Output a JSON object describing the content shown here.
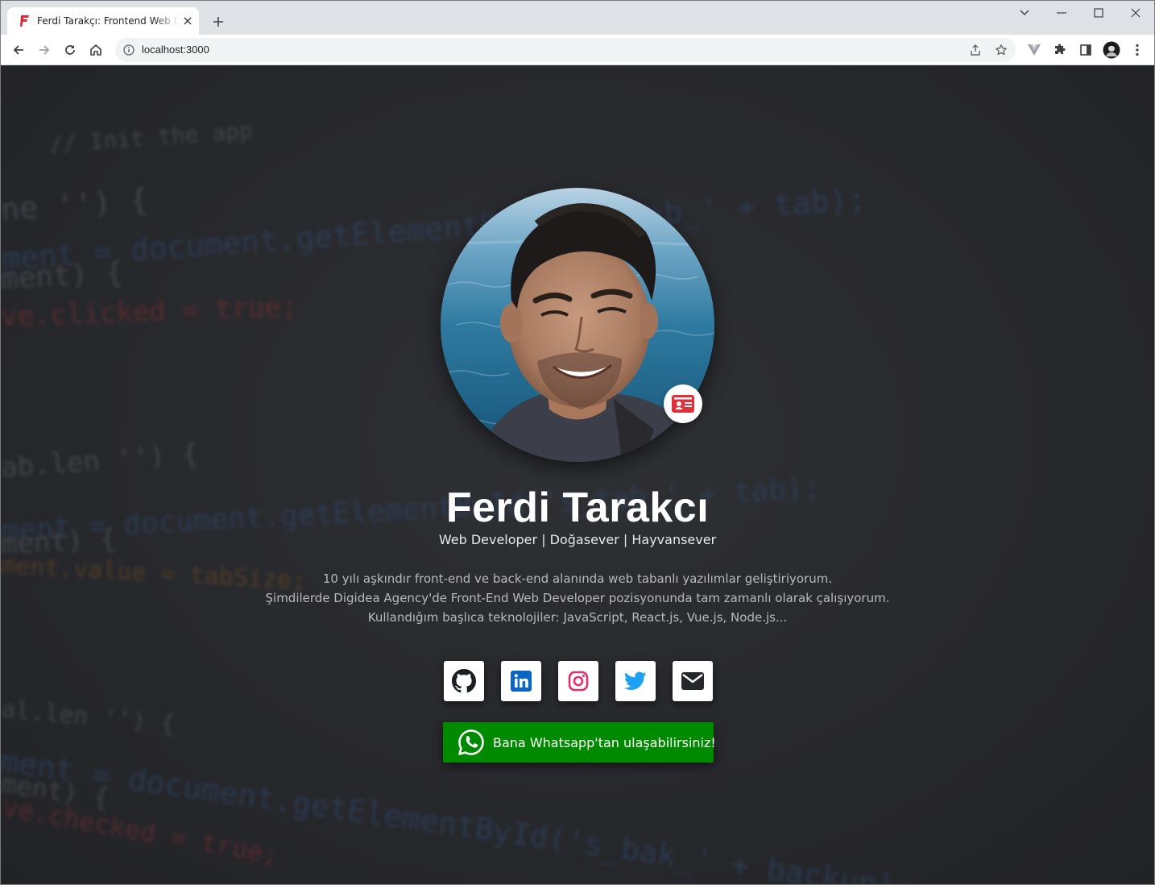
{
  "browser": {
    "tab_title": "Ferdi Tarakçı: Frontend Web Developer",
    "url": "localhost:3000",
    "colors": {
      "favicon": "#e0282f",
      "tabstrip": "#dee1e6"
    }
  },
  "background_code": {
    "lines": [
      "  // Init the app",
      "ne '') {",
      "ment = document.getElementById('s_tab_' + tab);",
      "ment) {",
      "ve.clicked = true;",
      "ab.len '') {",
      "ment = document.getElementById('s_tab_' + tab);",
      "ment) {",
      "ment.value = tabSize;",
      "al.len '') {",
      "ment = document.getElementById('s_bak_' + backup);",
      "ment) {",
      "ve.checked = true;"
    ]
  },
  "profile": {
    "name": "Ferdi Tarakcı",
    "roles": "Web Developer | Doğasever | Hayvansever",
    "bio": [
      "10 yılı aşkındır front-end ve back-end alanında web tabanlı yazılımlar geliştiriyorum.",
      "Şimdilerde Digidea Agency'de Front-End Web Developer pozisyonunda tam zamanlı olarak çalışıyorum.",
      "Kullandığım başlıca teknolojiler: JavaScript, React.js, Vue.js, Node.js..."
    ],
    "badge_icon": "id-card-icon",
    "colors": {
      "badge": "#e0313b"
    }
  },
  "social": [
    {
      "icon": "github-icon",
      "color": "#1b1f23"
    },
    {
      "icon": "linkedin-icon",
      "color": "#0a66c2"
    },
    {
      "icon": "instagram-icon",
      "color": "#e1306c"
    },
    {
      "icon": "twitter-icon",
      "color": "#1da1f2"
    },
    {
      "icon": "envelope-icon",
      "color": "#25262a"
    }
  ],
  "whatsapp": {
    "label": "Bana Whatsapp'tan ulaşabilirsiniz!",
    "icon": "whatsapp-icon",
    "color": "#008a00"
  }
}
